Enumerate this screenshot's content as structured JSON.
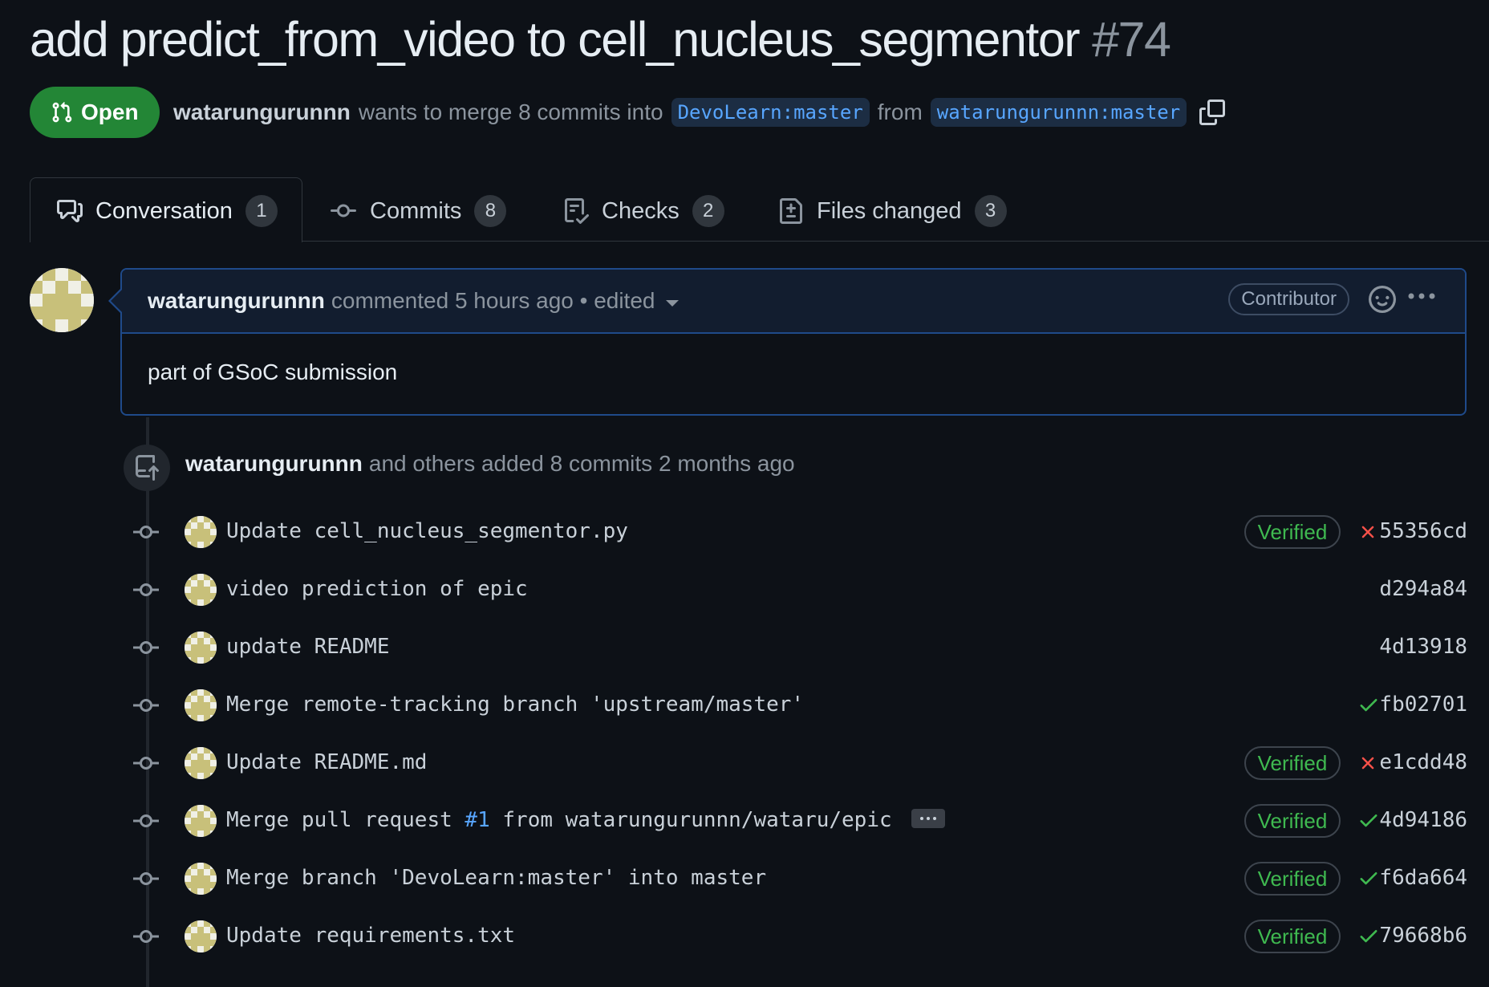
{
  "pr": {
    "title": "add predict_from_video to cell_nucleus_segmentor",
    "number": "#74",
    "state": "Open",
    "author": "watarungurunnn",
    "merge_text_1": "wants to merge 8 commits into",
    "base_branch": "DevoLearn:master",
    "merge_text_2": "from",
    "head_branch": "watarungurunnn:master"
  },
  "tabs": [
    {
      "label": "Conversation",
      "count": "1"
    },
    {
      "label": "Commits",
      "count": "8"
    },
    {
      "label": "Checks",
      "count": "2"
    },
    {
      "label": "Files changed",
      "count": "3"
    }
  ],
  "comment": {
    "author": "watarungurunnn",
    "meta": "commented 5 hours ago • edited",
    "role": "Contributor",
    "body": "part of GSoC submission"
  },
  "push_event": {
    "author": "watarungurunnn",
    "text": "and others added 8 commits 2 months ago"
  },
  "commits": [
    {
      "message": "Update cell_nucleus_segmentor.py",
      "verified": "Verified",
      "status": "fail",
      "sha": "55356cd"
    },
    {
      "message": "video prediction of epic",
      "verified": "",
      "status": "none",
      "sha": "d294a84"
    },
    {
      "message": "update README",
      "verified": "",
      "status": "none",
      "sha": "4d13918"
    },
    {
      "message": "Merge remote-tracking branch 'upstream/master'",
      "verified": "",
      "status": "success",
      "sha": "fb02701"
    },
    {
      "message": "Update README.md",
      "verified": "Verified",
      "status": "fail",
      "sha": "e1cdd48"
    },
    {
      "message_pre": "Merge pull request ",
      "message_link": "#1",
      "message_post": " from watarungurunnn/wataru/epic",
      "verified": "Verified",
      "status": "success",
      "sha": "4d94186"
    },
    {
      "message": "Merge branch 'DevoLearn:master' into master",
      "verified": "Verified",
      "status": "success",
      "sha": "f6da664"
    },
    {
      "message": "Update requirements.txt",
      "verified": "Verified",
      "status": "success",
      "sha": "79668b6"
    }
  ],
  "colors": {
    "background": "#0d1117",
    "open_green": "#238636",
    "link_blue": "#58a6ff",
    "success": "#3fb950",
    "fail": "#f85149",
    "avatar": "#c8c07a"
  }
}
